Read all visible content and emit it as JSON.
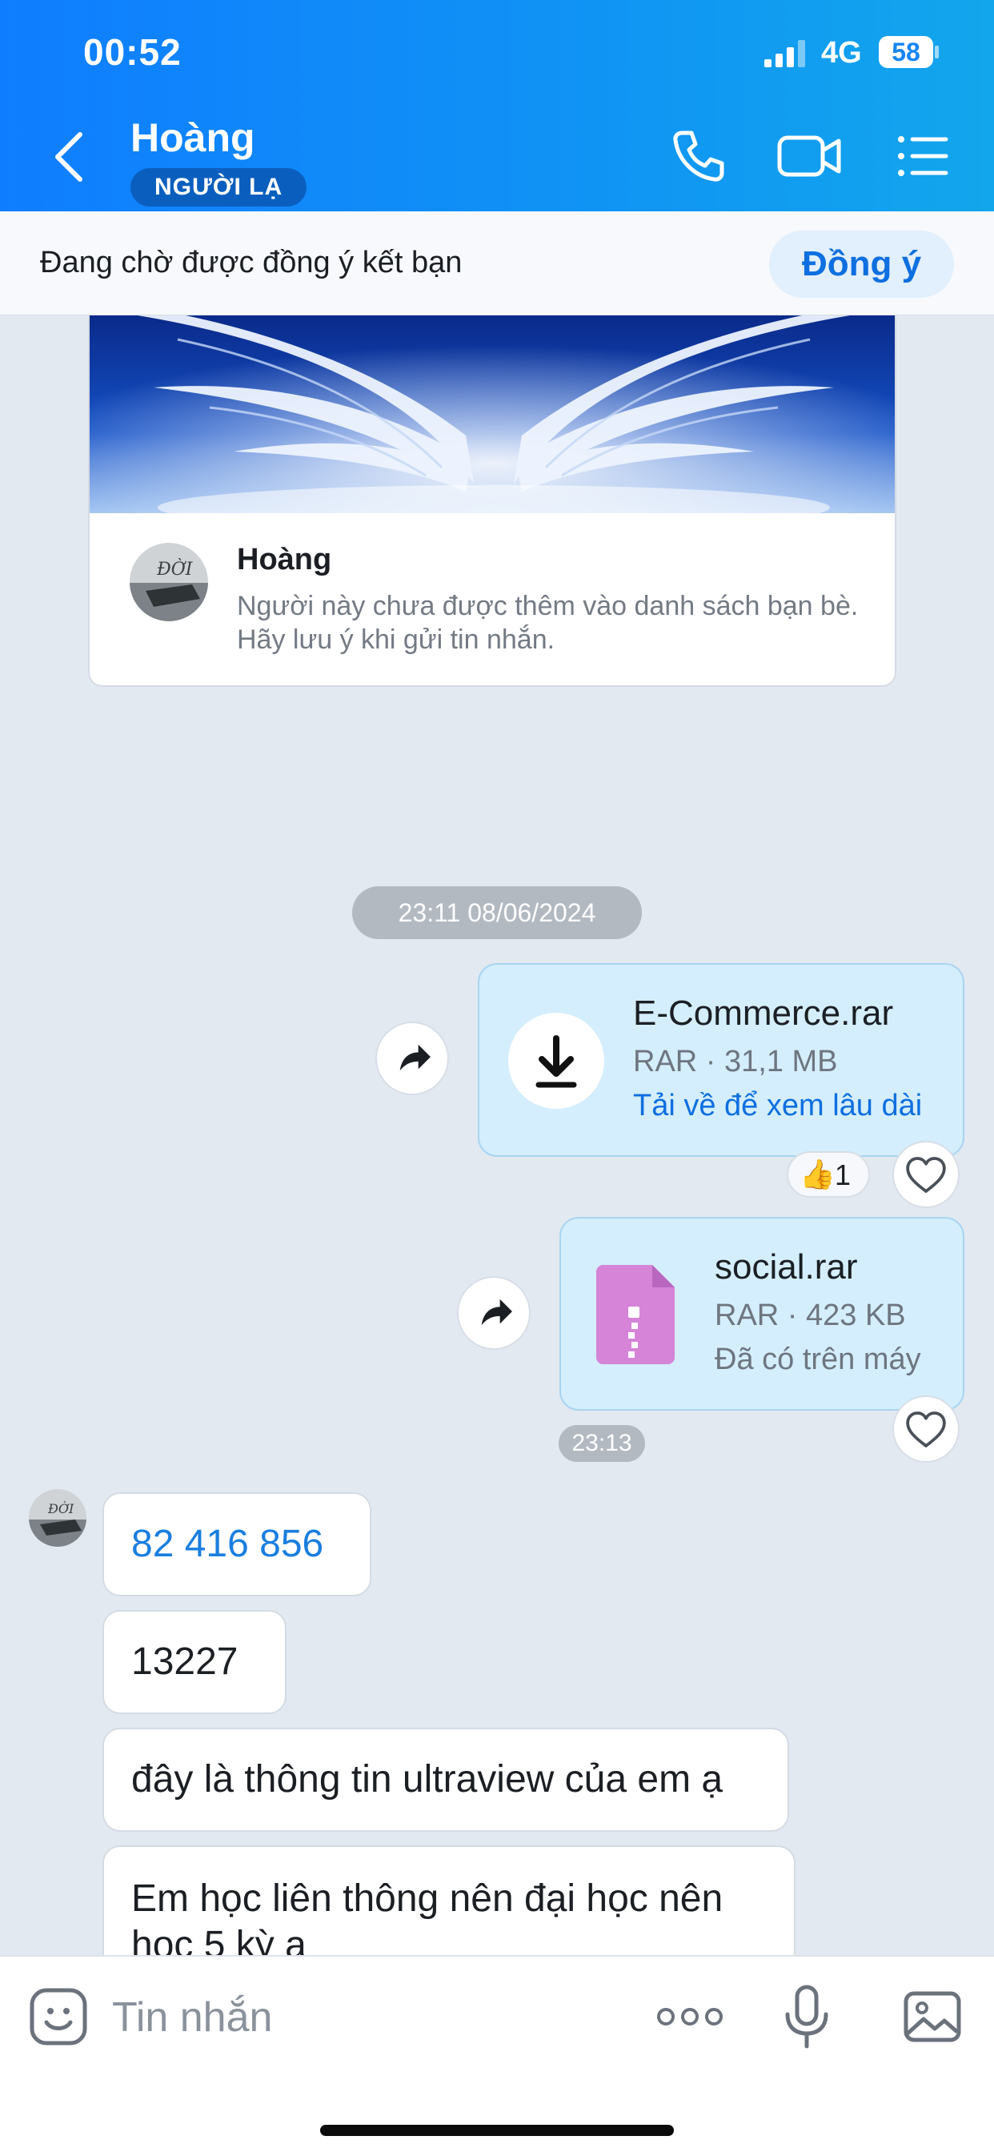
{
  "status_bar": {
    "time": "00:52",
    "network": "4G",
    "battery": "58"
  },
  "header": {
    "name": "Hoàng",
    "badge": "NGƯỜI LẠ"
  },
  "friend_request": {
    "text": "Đang chờ được đồng ý kết bạn",
    "accept_label": "Đồng ý"
  },
  "profile_card": {
    "name": "Hoàng",
    "note": "Người này chưa được thêm vào danh sách bạn bè. Hãy lưu ý khi gửi tin nhắn."
  },
  "conversation": {
    "date_separator": "23:11 08/06/2024",
    "files": [
      {
        "name": "E-Commerce.rar",
        "meta": "RAR · 31,1 MB",
        "action": "Tải về để xem lâu dài",
        "reaction": {
          "emoji": "👍",
          "count": "1"
        }
      },
      {
        "name": "social.rar",
        "meta": "RAR · 423 KB",
        "status": "Đã có trên máy",
        "time": "23:13"
      }
    ],
    "incoming": [
      "82 416 856",
      "13227",
      "đây là thông tin ultraview của em ạ",
      "Em học liên thông nên đại học nên học 5 kỳ ạ"
    ]
  },
  "composer": {
    "placeholder": "Tin nhắn"
  },
  "colors": {
    "header_start": "#0f7dff",
    "header_end": "#12a6ec",
    "accent": "#0d6fe0",
    "outgoing_bubble": "#d4eefd",
    "chat_bg": "#e2e9f1"
  }
}
